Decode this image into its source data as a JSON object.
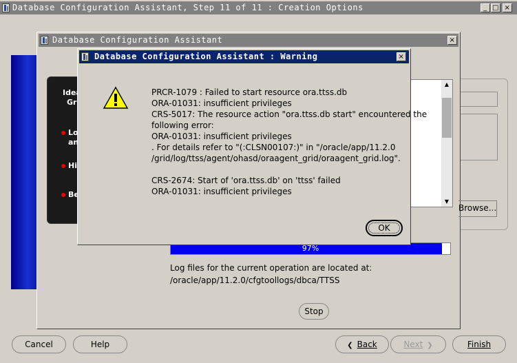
{
  "main_window": {
    "title": "Database Configuration Assistant, Step 11 of 11 : Creation Options",
    "controls": [
      "_",
      "□",
      "×"
    ]
  },
  "bottom_buttons": {
    "cancel": "Cancel",
    "help": "Help",
    "back": "Back",
    "next": "Next",
    "finish": "Finish"
  },
  "progress_dialog": {
    "title": "Database Configuration Assistant",
    "close": "×",
    "right_panel_button": "Browse...",
    "progress_percent": 97,
    "progress_label": "97%",
    "log_line1": "Log files for the current operation are located at:",
    "log_line2": "/oracle/app/11.2.0/cfgtoollogs/dbca/TTSS",
    "stop_label": "Stop",
    "background_panel": {
      "heading_partial": "Idea",
      "heading_partial2": "Gr",
      "bullets": [
        "Lo",
        "an",
        "Hi",
        "Be"
      ]
    }
  },
  "warning_dialog": {
    "title": "Database Configuration Assistant : Warning",
    "close": "×",
    "message_lines": [
      "PRCR-1079 : Failed to start resource ora.ttss.db",
      "ORA-01031: insufficient privileges",
      "CRS-5017: The resource action \"ora.ttss.db start\" encountered the",
      "following error:",
      "ORA-01031: insufficient privileges",
      ". For details refer to \"(:CLSN00107:)\" in \"/oracle/app/11.2.0",
      "/grid/log/ttss/agent/ohasd/oraagent_grid/oraagent_grid.log\".",
      "",
      "CRS-2674: Start of 'ora.ttss.db' on 'ttss' failed",
      "ORA-01031: insufficient privileges"
    ],
    "ok_label": "OK"
  },
  "colors": {
    "titlebar_active": "#0a246a",
    "titlebar_inactive": "#808080",
    "progress_fill": "#0000ee",
    "window_bg": "#d4d0c8"
  }
}
